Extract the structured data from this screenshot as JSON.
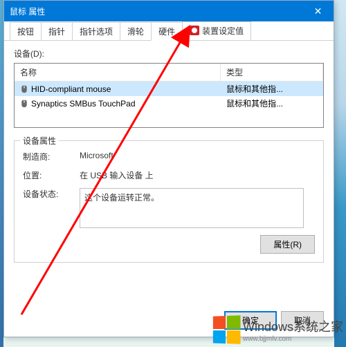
{
  "window": {
    "title": "鼠标 属性"
  },
  "tabs": {
    "buttons": "按钮",
    "pointers": "指针",
    "pointer_options": "指针选项",
    "wheel": "滑轮",
    "hardware": "硬件",
    "device_settings": "装置设定值"
  },
  "device_list": {
    "label": "设备(D):",
    "col_name": "名称",
    "col_type": "类型",
    "rows": [
      {
        "name": "HID-compliant mouse",
        "type": "鼠标和其他指..."
      },
      {
        "name": "Synaptics SMBus TouchPad",
        "type": "鼠标和其他指..."
      }
    ]
  },
  "properties": {
    "legend": "设备属性",
    "mfr_label": "制造商:",
    "mfr_value": "Microsoft",
    "loc_label": "位置:",
    "loc_value": "在 USB 输入设备 上",
    "status_label": "设备状态:",
    "status_value": "这个设备运转正常。"
  },
  "buttons": {
    "props": "属性(R)",
    "ok": "确定",
    "cancel": "取消"
  },
  "watermark": {
    "main": "Windows系统之家",
    "sub": "www.bjjmlv.com"
  }
}
